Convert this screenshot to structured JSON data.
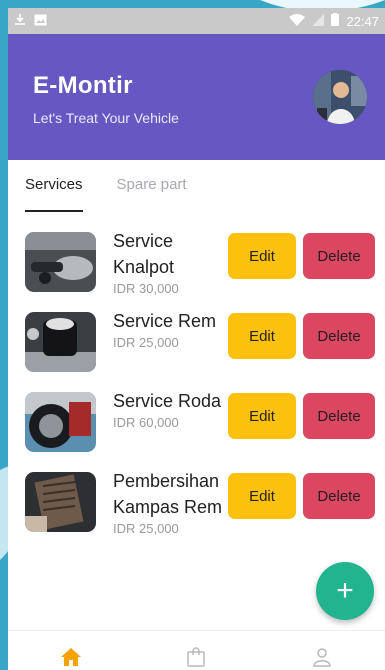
{
  "status_bar": {
    "time": "22:47",
    "icons": [
      "download-icon",
      "image-icon",
      "wifi-icon",
      "signal-icon",
      "battery-icon"
    ]
  },
  "header": {
    "title": "E-Montir",
    "subtitle": "Let's Treat Your Vehicle"
  },
  "tabs": [
    {
      "label": "Services",
      "active": true
    },
    {
      "label": "Spare part",
      "active": false
    }
  ],
  "services": [
    {
      "name": "Service Knalpot",
      "price": "IDR 30,000",
      "edit_label": "Edit",
      "delete_label": "Delete"
    },
    {
      "name": "Service Rem",
      "price": "IDR 25,000",
      "edit_label": "Edit",
      "delete_label": "Delete"
    },
    {
      "name": "Service Roda",
      "price": "IDR 60,000",
      "edit_label": "Edit",
      "delete_label": "Delete"
    },
    {
      "name": "Pembersihan Kampas Rem",
      "price": "IDR 25,000",
      "edit_label": "Edit",
      "delete_label": "Delete"
    }
  ],
  "fab": {
    "label": "+"
  },
  "bottom_nav": [
    {
      "icon": "home-icon",
      "active": true
    },
    {
      "icon": "shopping-bag-icon",
      "active": false
    },
    {
      "icon": "user-icon",
      "active": false
    }
  ],
  "colors": {
    "header": "#6657c2",
    "edit": "#fcc10d",
    "delete": "#dc4660",
    "fab": "#22b38f",
    "nav_active": "#f5a300"
  }
}
